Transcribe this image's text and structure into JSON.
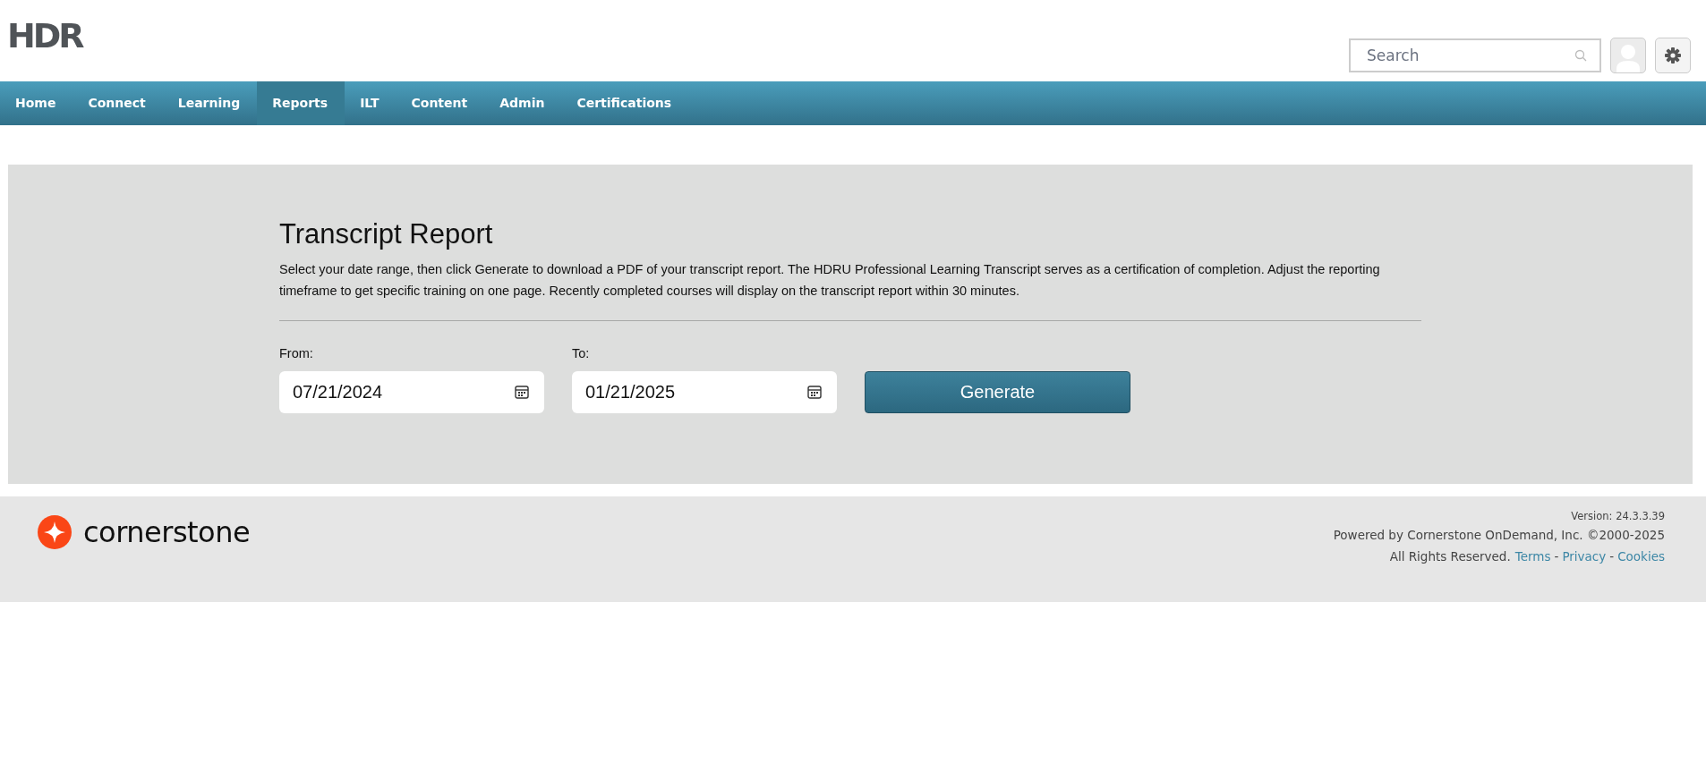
{
  "header": {
    "logo": "HDR",
    "search": {
      "placeholder": "Search"
    }
  },
  "nav": [
    {
      "label": "Home",
      "selected": false
    },
    {
      "label": "Connect",
      "selected": false
    },
    {
      "label": "Learning",
      "selected": false
    },
    {
      "label": "Reports",
      "selected": true
    },
    {
      "label": "ILT",
      "selected": false
    },
    {
      "label": "Content",
      "selected": false
    },
    {
      "label": "Admin",
      "selected": false
    },
    {
      "label": "Certifications",
      "selected": false
    }
  ],
  "report": {
    "title": "Transcript Report",
    "description": "Select your date range, then click Generate to download a PDF of your transcript report. The HDRU Professional Learning Transcript serves as a certification of completion. Adjust the reporting timeframe to get specific training on one page. Recently completed courses will display on the transcript report within 30 minutes.",
    "fields": [
      {
        "label": "From:",
        "value": "07/21/2024"
      },
      {
        "label": "To:",
        "value": "01/21/2025"
      }
    ],
    "button": "Generate"
  },
  "footer": {
    "brand": "cornerstone",
    "version": "Version: 24.3.3.39",
    "powered": "Powered by Cornerstone OnDemand, Inc. ©2000-2025",
    "rights": "All Rights Reserved.",
    "links": [
      "Terms",
      "Privacy",
      "Cookies"
    ],
    "separator": "-"
  }
}
